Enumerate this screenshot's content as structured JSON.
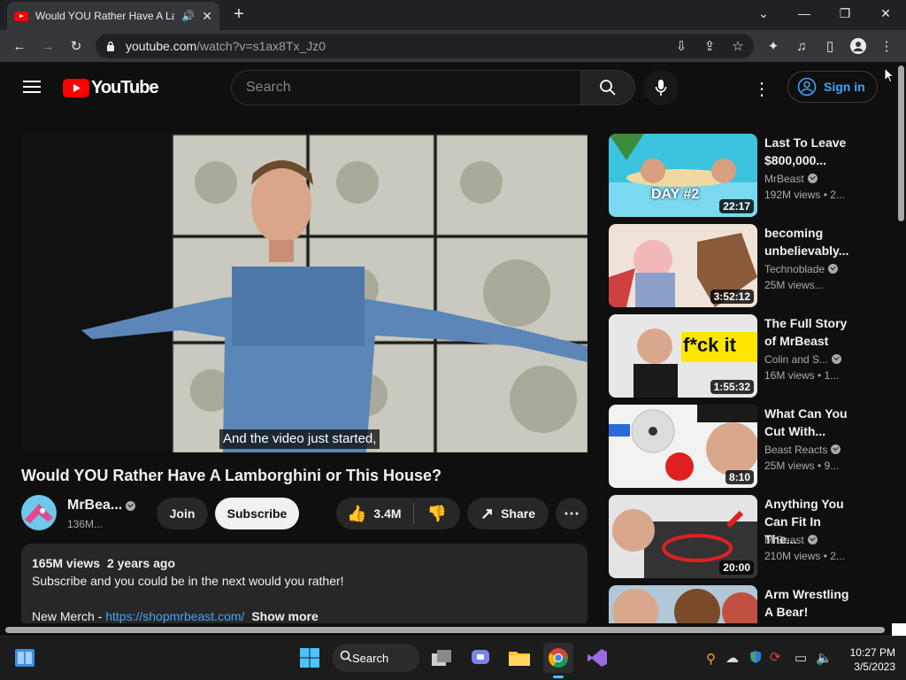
{
  "browser": {
    "tab_title": "Would YOU Rather Have A La",
    "url_host": "youtube.com",
    "url_path": "/watch?v=s1ax8Tx_Jz0"
  },
  "youtube": {
    "logo_text": "YouTube",
    "search_placeholder": "Search",
    "signin_label": "Sign in"
  },
  "video": {
    "caption": "And the video just started,",
    "title": "Would YOU Rather Have A Lamborghini or This House?",
    "channel": "MrBea...",
    "subscribers": "136M...",
    "join_label": "Join",
    "subscribe_label": "Subscribe",
    "likes": "3.4M",
    "share_label": "Share",
    "views": "165M views",
    "age": "2 years ago",
    "description_line1": "Subscribe and you could be in the next would you rather!",
    "merch_prefix": "New Merch - ",
    "merch_link": "https://shopmrbeast.com/",
    "show_more": "Show more"
  },
  "recommendations": [
    {
      "title": "Last To Leave $800,000...",
      "channel": "MrBeast",
      "verified": true,
      "meta": "192M views  • 2...",
      "duration": "22:17"
    },
    {
      "title": "becoming unbelievably...",
      "channel": "Technoblade",
      "verified": true,
      "meta": "25M views...",
      "duration": "3:52:12"
    },
    {
      "title": "The Full Story of MrBeast",
      "channel": "Colin and S...",
      "verified": true,
      "meta": "16M views  • 1...",
      "duration": "1:55:32"
    },
    {
      "title": "What Can You Cut With...",
      "channel": "Beast Reacts",
      "verified": true,
      "meta": "25M views  • 9...",
      "duration": "8:10"
    },
    {
      "title": "Anything You Can Fit In The...",
      "channel": "MrBeast",
      "verified": true,
      "meta": "210M views  • 2...",
      "duration": "20:00"
    },
    {
      "title": "Arm Wrestling A Bear!",
      "channel": "",
      "verified": false,
      "meta": "",
      "duration": ""
    }
  ],
  "thumb_text": {
    "day2": "DAY #2",
    "fck": "f*ck it"
  },
  "taskbar": {
    "search_label": "Search",
    "time": "10:27 PM",
    "date": "3/5/2023"
  },
  "colors": {
    "accent_red": "#ff0000",
    "link_blue": "#3ea6ff"
  }
}
